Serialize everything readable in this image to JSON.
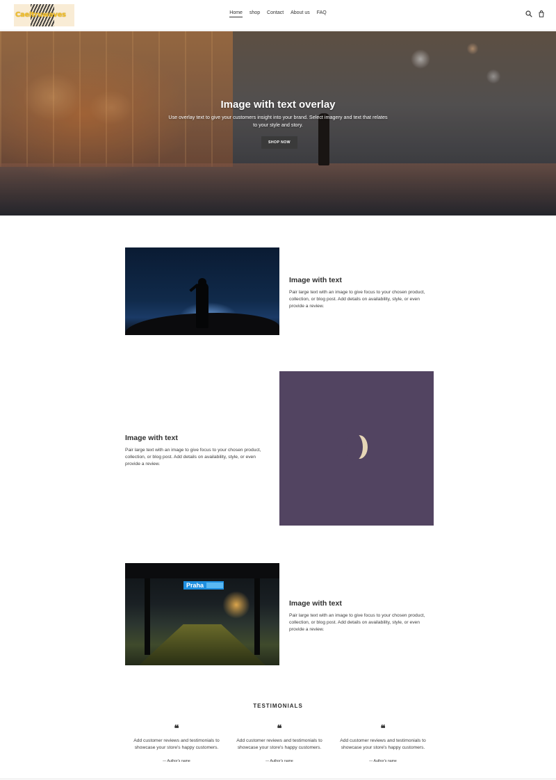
{
  "header": {
    "logo_text": "Caeltruwaves",
    "nav": [
      "Home",
      "shop",
      "Contact",
      "About us",
      "FAQ"
    ],
    "active_nav": "Home",
    "icons": [
      "search-icon",
      "cart-icon"
    ]
  },
  "hero": {
    "title": "Image with text overlay",
    "subtitle": "Use overlay text to give your customers insight into your brand. Select imagery and text that relates to your style and story.",
    "button": "SHOP NOW"
  },
  "sections": [
    {
      "title": "Image with text",
      "text": "Pair large text with an image to give focus to your chosen product, collection, or blog post. Add details on availability, style, or even provide a review."
    },
    {
      "title": "Image with text",
      "text": "Pair large text with an image to give focus to your chosen product, collection, or blog post. Add details on availability, style, or even provide a review."
    },
    {
      "title": "Image with text",
      "text": "Pair large text with an image to give focus to your chosen product, collection, or blog post. Add details on availability, style, or even provide a review.",
      "sign": "Praha"
    }
  ],
  "testimonials": {
    "heading": "TESTIMONIALS",
    "items": [
      {
        "quote_mark": "❝",
        "text": "Add customer reviews and testimonials to showcase your store's happy customers.",
        "author": "— Author's name"
      },
      {
        "quote_mark": "❝",
        "text": "Add customer reviews and testimonials to showcase your store's happy customers.",
        "author": "— Author's name"
      },
      {
        "quote_mark": "❝",
        "text": "Add customer reviews and testimonials to showcase your store's happy customers.",
        "author": "— Author's name"
      }
    ]
  },
  "colors": {
    "button_bg": "#3a3a3a",
    "text": "#3a3a3a",
    "logo_bg": "#f9ecd5",
    "logo_text": "#f2c12e"
  }
}
